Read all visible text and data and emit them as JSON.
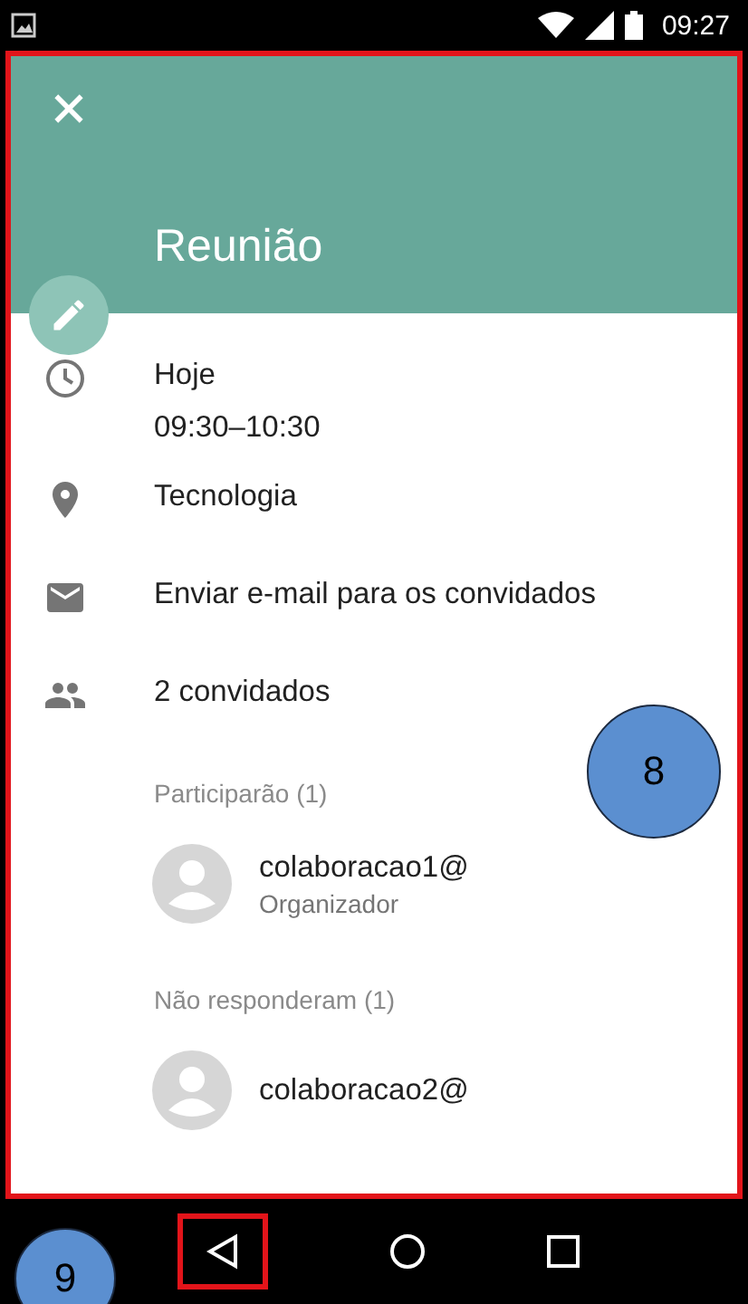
{
  "status_bar": {
    "time": "09:27"
  },
  "event": {
    "title": "Reunião",
    "date": "Hoje",
    "time": "09:30–10:30",
    "location": "Tecnologia",
    "email_action": "Enviar e-mail para os convidados",
    "guest_count": "2 convidados"
  },
  "guest_groups": [
    {
      "heading": "Participarão (1)",
      "guests": [
        {
          "name": "colaboracao1@",
          "role": "Organizador"
        }
      ]
    },
    {
      "heading": "Não responderam (1)",
      "guests": [
        {
          "name": "colaboracao2@"
        }
      ]
    }
  ],
  "annotations": [
    {
      "label": "8"
    },
    {
      "label": "9"
    }
  ]
}
